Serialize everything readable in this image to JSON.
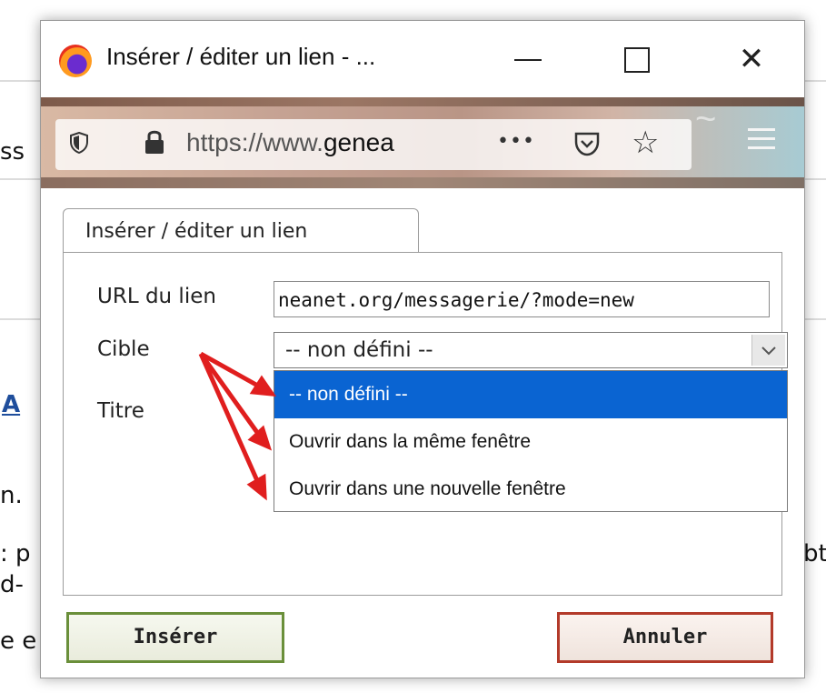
{
  "background": {
    "fragments": [
      "ss",
      "A",
      "n.",
      ": p",
      "d-",
      "e e",
      "bt"
    ]
  },
  "window": {
    "title": "Insérer / éditer un lien - ...",
    "minimize_icon": "minimize-icon",
    "maximize_icon": "maximize-icon",
    "close_glyph": "✕"
  },
  "urlbar": {
    "scheme": "https://www.",
    "domain": "genea",
    "more_glyph": "•••",
    "star_glyph": "☆"
  },
  "dialog": {
    "tab_label": "Insérer / éditer un lien",
    "url_label": "URL du lien",
    "url_value": "neanet.org/messagerie/?mode=new",
    "target_label": "Cible",
    "title_label": "Titre",
    "target_selected": "-- non défini --",
    "target_options": [
      "-- non défini --",
      "Ouvrir dans la même fenêtre",
      "Ouvrir dans une nouvelle fenêtre"
    ],
    "insert_button": "Insérer",
    "cancel_button": "Annuler"
  },
  "colors": {
    "selection": "#0a64d2",
    "annotation_arrow": "#e01e1e",
    "insert_border": "#6a8f3a",
    "cancel_border": "#b33a2a"
  }
}
